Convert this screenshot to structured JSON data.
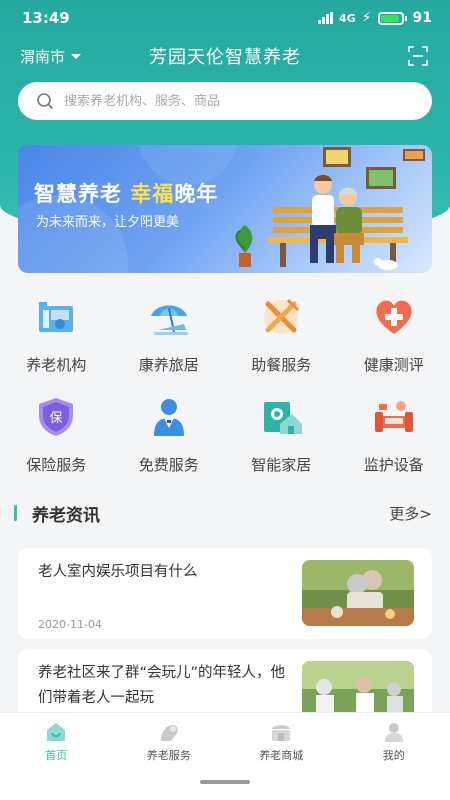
{
  "status": {
    "time": "13:49",
    "network": "4G",
    "battery": "91"
  },
  "topbar": {
    "city": "渭南市",
    "title": "芳园天伦智慧养老"
  },
  "search": {
    "placeholder": "搜索养老机构、服务、商品"
  },
  "banner": {
    "title_a": "智慧养老 ",
    "title_b": "幸福",
    "title_c": "晚年",
    "subtitle": "为未来而来，让夕阳更美"
  },
  "categories": [
    {
      "label": "养老机构",
      "icon": "nursing-home-icon"
    },
    {
      "label": "康养旅居",
      "icon": "beach-umbrella-icon"
    },
    {
      "label": "助餐服务",
      "icon": "fork-knife-icon"
    },
    {
      "label": "健康测评",
      "icon": "heart-plus-icon"
    },
    {
      "label": "保险服务",
      "icon": "shield-icon"
    },
    {
      "label": "免费服务",
      "icon": "waiter-icon"
    },
    {
      "label": "智能家居",
      "icon": "smart-home-icon"
    },
    {
      "label": "监护设备",
      "icon": "monitor-bed-icon"
    }
  ],
  "news": {
    "title": "养老资讯",
    "more": "更多>",
    "items": [
      {
        "title": "老人室内娱乐项目有什么",
        "date": "2020-11-04"
      },
      {
        "title": "养老社区来了群“会玩儿”的年轻人，他们带着老人一起玩",
        "date": ""
      }
    ]
  },
  "tabs": [
    {
      "label": "首页",
      "icon": "home-icon",
      "active": true
    },
    {
      "label": "养老服务",
      "icon": "service-icon",
      "active": false
    },
    {
      "label": "养老商城",
      "icon": "mall-icon",
      "active": false
    },
    {
      "label": "我的",
      "icon": "profile-icon",
      "active": false
    }
  ],
  "colors": {
    "primary": "#37bcb0",
    "banner": "#4a86e8",
    "highlight": "#ffe14d"
  }
}
